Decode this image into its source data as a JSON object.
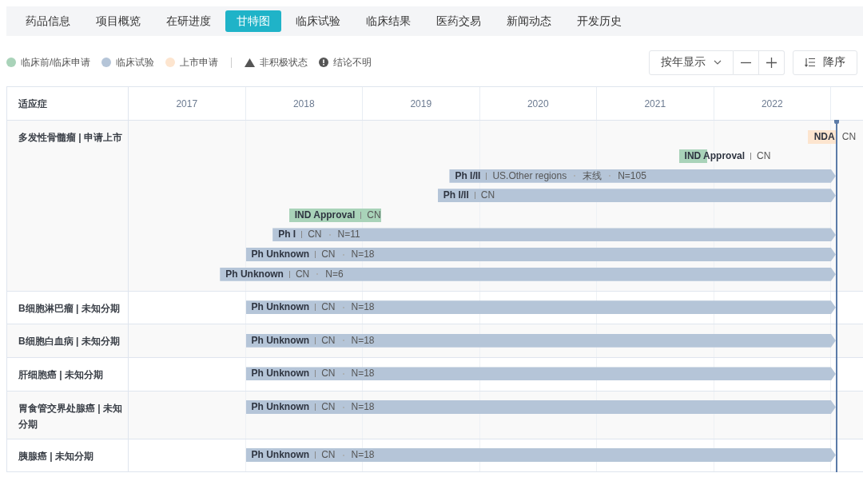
{
  "tabs": [
    {
      "label": "药品信息",
      "selected": false
    },
    {
      "label": "项目概览",
      "selected": false
    },
    {
      "label": "在研进度",
      "selected": false
    },
    {
      "label": "甘特图",
      "selected": true
    },
    {
      "label": "临床试验",
      "selected": false
    },
    {
      "label": "临床结果",
      "selected": false
    },
    {
      "label": "医药交易",
      "selected": false
    },
    {
      "label": "新闻动态",
      "selected": false
    },
    {
      "label": "开发历史",
      "selected": false
    }
  ],
  "legend": {
    "items": [
      {
        "kind": "preclinical",
        "label": "临床前/临床申请",
        "color": "#a9d3b9"
      },
      {
        "kind": "clinical",
        "label": "临床试验",
        "color": "#b5c5d8"
      },
      {
        "kind": "filing",
        "label": "上市申请",
        "color": "#fde5cf"
      },
      {
        "kind": "inactive",
        "label": "非积极状态"
      },
      {
        "kind": "unclear",
        "label": "结论不明"
      }
    ]
  },
  "toolbar": {
    "view_select": {
      "value": "按年显示"
    },
    "sort_button": {
      "label": "降序"
    }
  },
  "gantt": {
    "header": "适应症",
    "columns": [
      "2017",
      "2018",
      "2019",
      "2020",
      "2021",
      "2022"
    ],
    "rows": [
      {
        "label": "多发性骨髓瘤 | 申请上市",
        "bars": [
          {
            "kind": "filing",
            "ongoing": false,
            "title": "NDA",
            "details": [
              "CN"
            ]
          },
          {
            "kind": "preclinical",
            "ongoing": false,
            "title": "IND Approval",
            "details": [
              "CN"
            ]
          },
          {
            "kind": "clinical",
            "ongoing": true,
            "title": "Ph I/II",
            "details": [
              "US.Other regions",
              "末线",
              "N=105"
            ]
          },
          {
            "kind": "clinical",
            "ongoing": true,
            "title": "Ph I/II",
            "details": [
              "CN"
            ]
          },
          {
            "kind": "preclinical",
            "ongoing": false,
            "title": "IND Approval",
            "details": [
              "CN"
            ]
          },
          {
            "kind": "clinical",
            "ongoing": true,
            "title": "Ph I",
            "details": [
              "CN",
              "N=11"
            ]
          },
          {
            "kind": "clinical",
            "ongoing": true,
            "title": "Ph Unknown",
            "details": [
              "CN",
              "N=18"
            ]
          },
          {
            "kind": "clinical",
            "ongoing": true,
            "title": "Ph Unknown",
            "details": [
              "CN",
              "N=6"
            ]
          }
        ]
      },
      {
        "label": "B细胞淋巴瘤 | 未知分期",
        "bars": [
          {
            "kind": "clinical",
            "ongoing": true,
            "title": "Ph Unknown",
            "details": [
              "CN",
              "N=18"
            ]
          }
        ]
      },
      {
        "label": "B细胞白血病 | 未知分期",
        "bars": [
          {
            "kind": "clinical",
            "ongoing": true,
            "title": "Ph Unknown",
            "details": [
              "CN",
              "N=18"
            ]
          }
        ]
      },
      {
        "label": "肝细胞癌 | 未知分期",
        "bars": [
          {
            "kind": "clinical",
            "ongoing": true,
            "title": "Ph Unknown",
            "details": [
              "CN",
              "N=18"
            ]
          }
        ]
      },
      {
        "label": "胃食管交界处腺癌 | 未知分期",
        "bars": [
          {
            "kind": "clinical",
            "ongoing": true,
            "title": "Ph Unknown",
            "details": [
              "CN",
              "N=18"
            ]
          }
        ]
      },
      {
        "label": "胰腺癌 | 未知分期",
        "bars": [
          {
            "kind": "clinical",
            "ongoing": true,
            "title": "Ph Unknown",
            "details": [
              "CN",
              "N=18"
            ]
          }
        ]
      }
    ]
  }
}
